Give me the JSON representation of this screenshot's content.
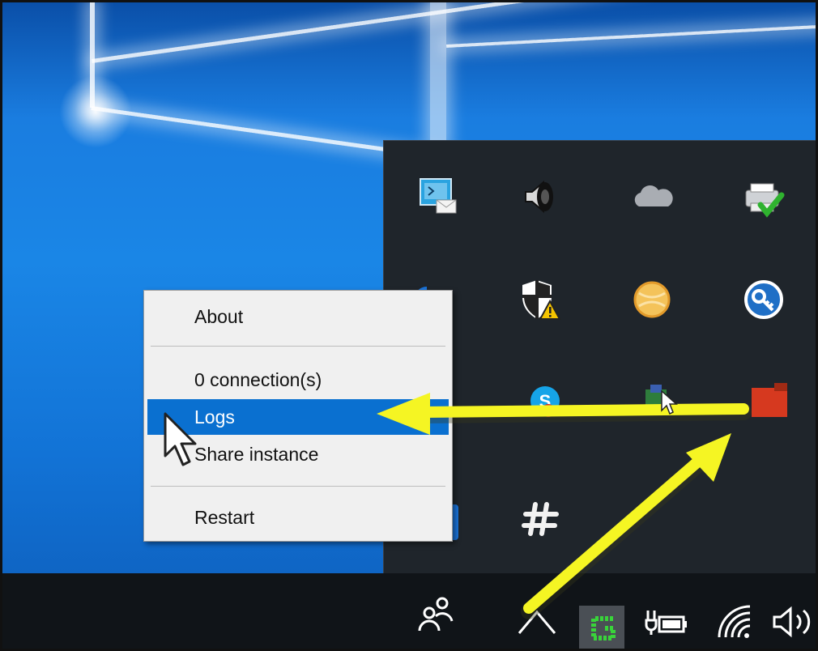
{
  "context_menu": {
    "items": [
      {
        "label": "About",
        "highlighted": false
      },
      {
        "label": "0 connection(s)",
        "highlighted": false
      },
      {
        "label": "Logs",
        "highlighted": true
      },
      {
        "label": "Share instance",
        "highlighted": false
      },
      {
        "label": "Restart",
        "highlighted": false
      }
    ],
    "highlight_color": "#0a70d0"
  },
  "tray_overflow": {
    "icons": [
      "remote-desktop-mail-icon",
      "speaker-icon",
      "onedrive-cloud-icon",
      "printer-check-icon",
      "bluetooth-icon",
      "windows-defender-warning-icon",
      "orange-ball-icon",
      "key-icon",
      "skype-icon",
      "green-app-icon",
      "red-app-icon",
      "network-drive-icon",
      "slack-hash-icon"
    ]
  },
  "taskbar": {
    "icons": [
      "people-icon",
      "show-hidden-icons-chevron",
      "green-g-app-icon",
      "battery-icon",
      "wifi-icon",
      "volume-icon"
    ]
  },
  "annotations": {
    "arrow_color": "#f5f523"
  },
  "colors": {
    "desktop_blue": "#1a7de0",
    "tray_bg": "#1f252b",
    "taskbar_bg": "#101418"
  }
}
